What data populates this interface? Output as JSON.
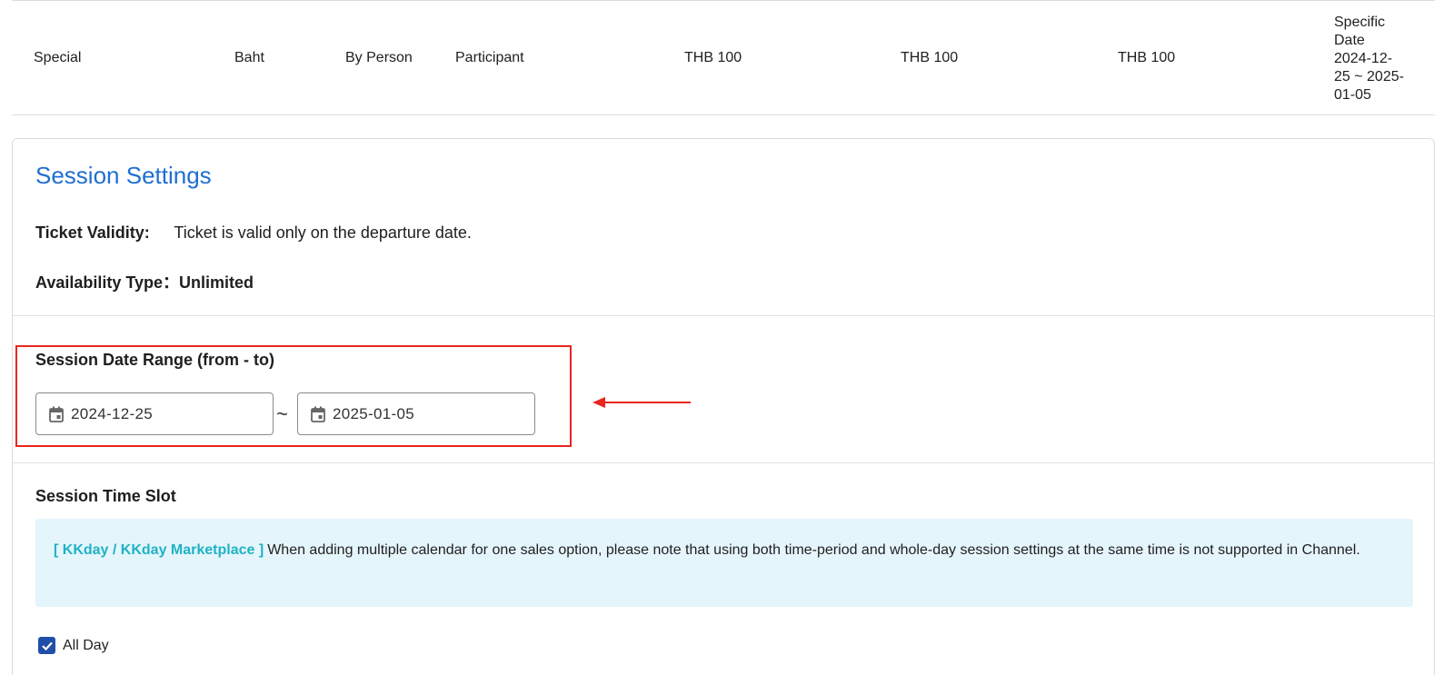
{
  "table_row": {
    "cells": [
      "Special",
      "Baht",
      "By Person",
      "Participant",
      "THB 100",
      "THB 100",
      "THB 100"
    ],
    "date_cell": [
      "Specific",
      "Date",
      "2024-12-",
      "25 ~ 2025-",
      "01-05"
    ]
  },
  "session": {
    "title": "Session Settings",
    "validity_label": "Ticket Validity:",
    "validity_value": "Ticket is valid only on the departure date.",
    "availability": "Availability Type：Unlimited",
    "range_label": "Session Date Range (from - to)",
    "date_from": "2024-12-25",
    "date_to": "2025-01-05",
    "range_separator": "~",
    "slot_title": "Session Time Slot",
    "notice_tag": "[ KKday / KKday Marketplace ]",
    "notice_text": "When adding multiple calendar for one sales option, please note that using both time-period and whole-day session settings at the same time is not supported in Channel.",
    "allday_label": "All Day",
    "allday_checked": true
  },
  "colors": {
    "title": "#1f6fd1",
    "highlight": "#e8261e",
    "notice_bg": "#e5f5fc",
    "notice_tag": "#1fb3c4",
    "checkbox": "#1f4fa8"
  },
  "icons": [
    "calendar-icon",
    "arrow-left-icon",
    "check-icon"
  ]
}
